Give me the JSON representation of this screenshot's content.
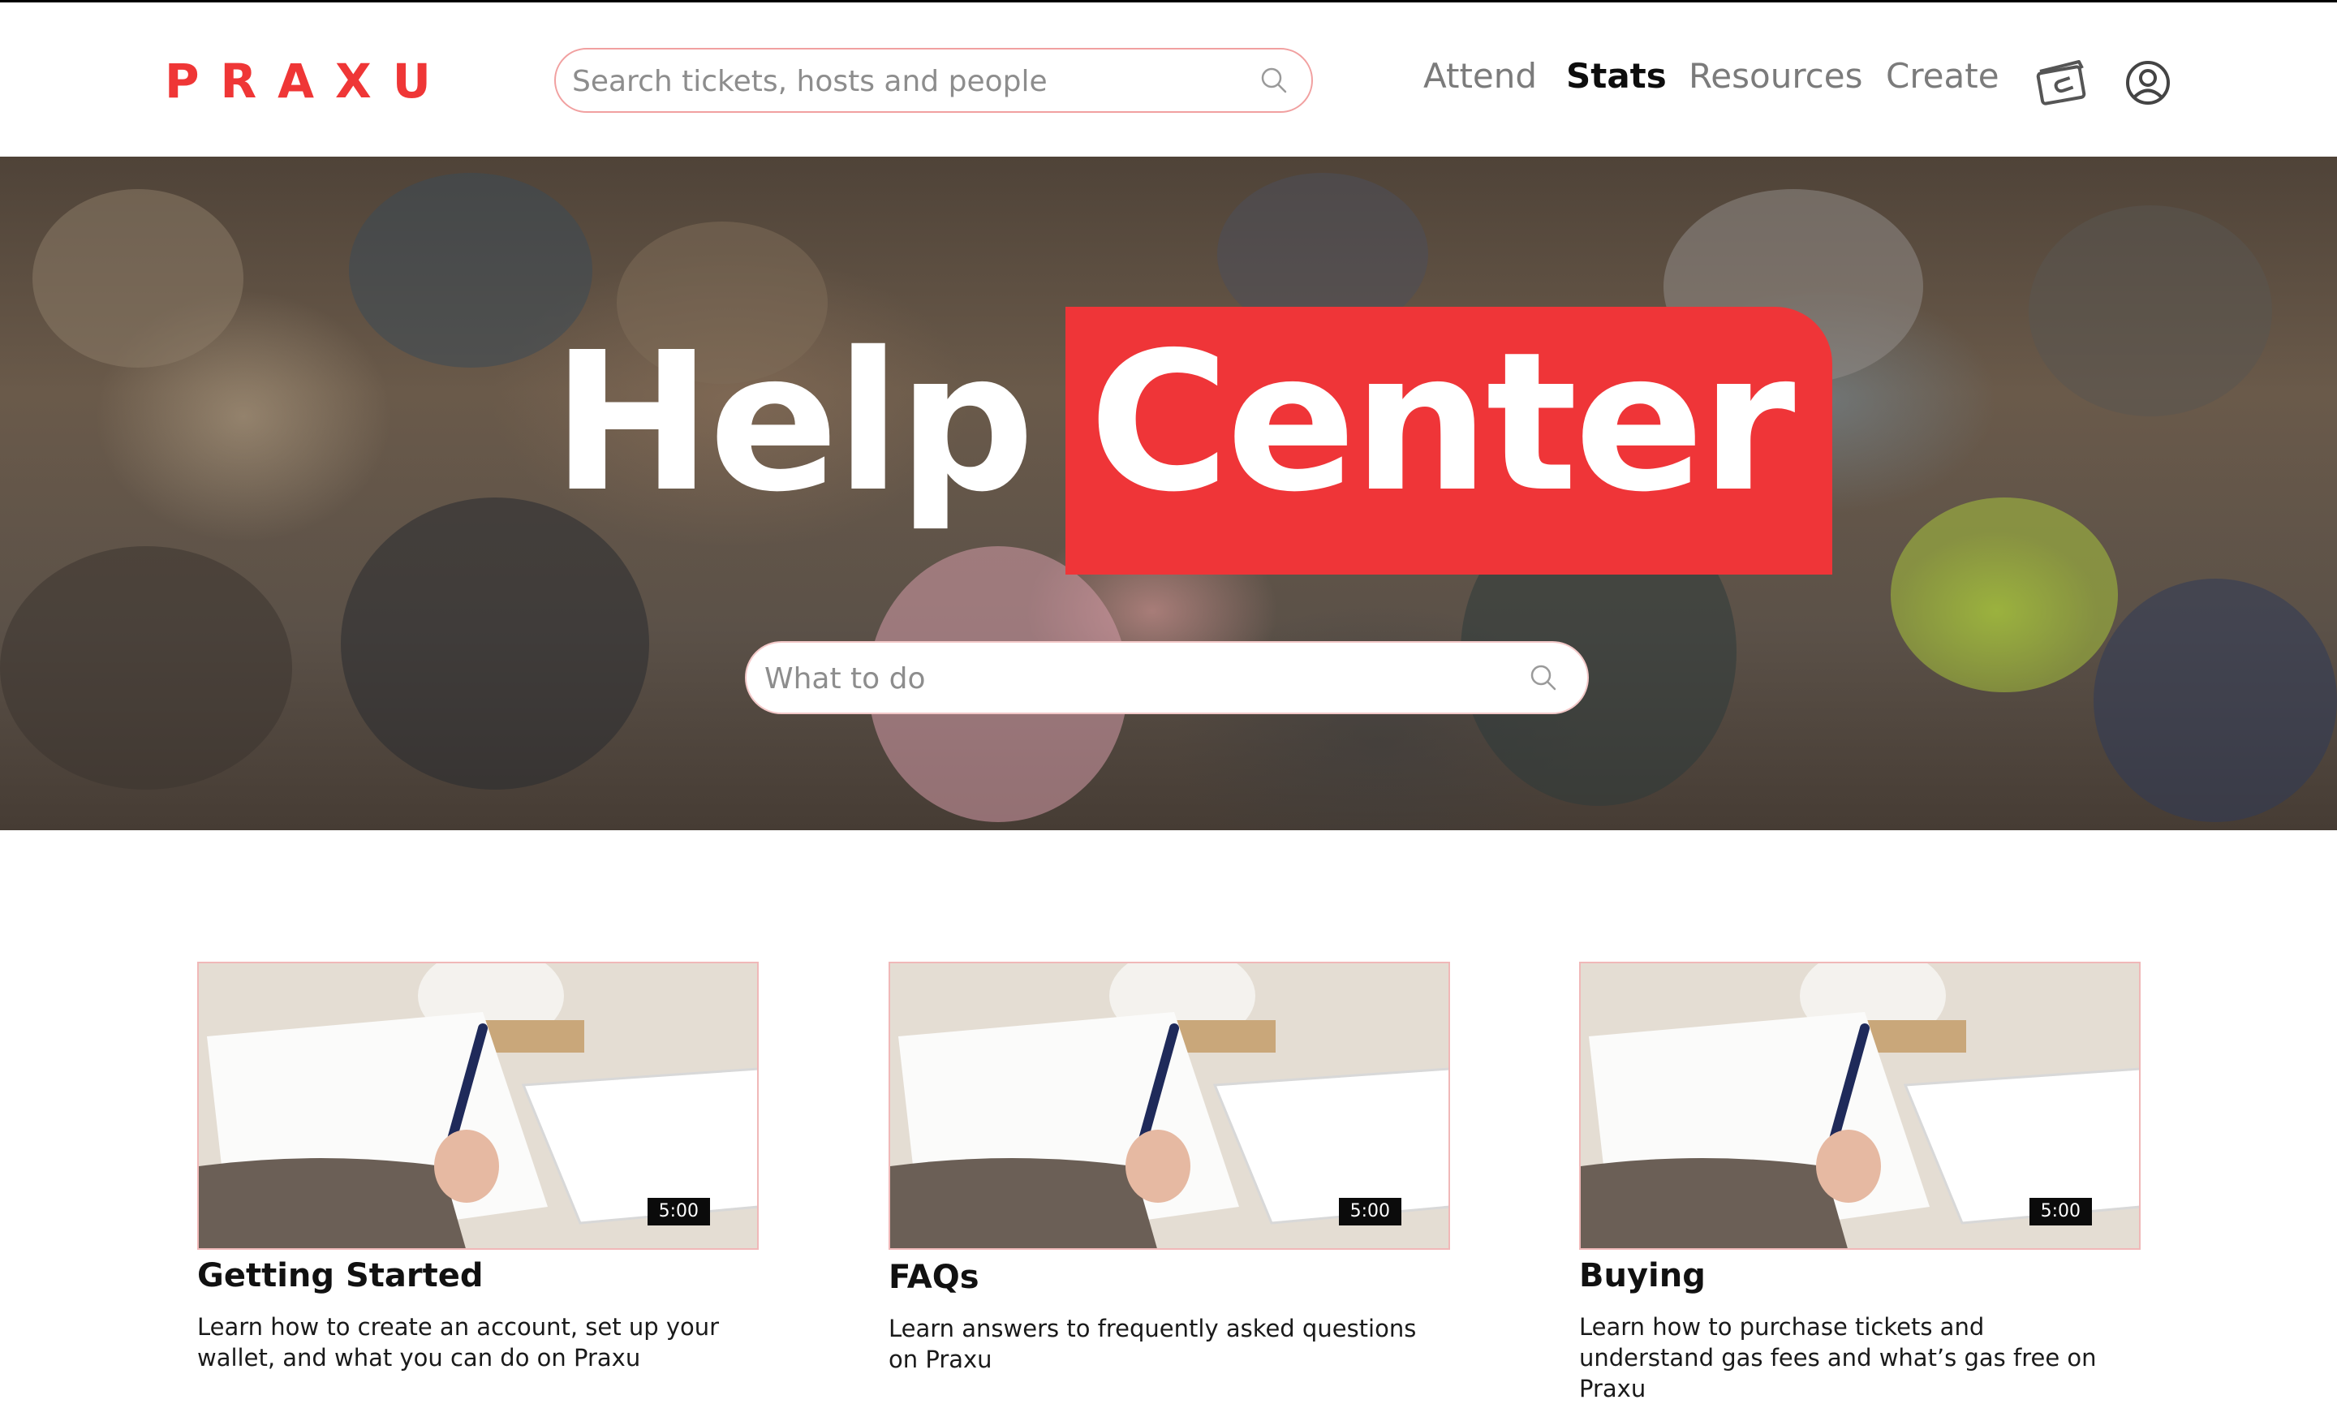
{
  "brand": {
    "logo_text": "PRAXU",
    "accent_color": "#ef3636"
  },
  "header": {
    "search_placeholder": "Search tickets, hosts and people",
    "search_icon": "search-icon",
    "nav": [
      {
        "label": "Attend",
        "active": false
      },
      {
        "label": "Stats",
        "active": true
      },
      {
        "label": "Resources",
        "active": false
      },
      {
        "label": "Create",
        "active": false
      }
    ],
    "wallet_icon": "wallet-icon",
    "profile_icon": "user-circle-icon"
  },
  "hero": {
    "title_part1": "Help",
    "title_part2": "Center",
    "search_placeholder": "What to do",
    "search_icon": "search-icon"
  },
  "cards": [
    {
      "title": "Getting Started",
      "description": "Learn how to create an account, set up your wallet, and what you can do on Praxu",
      "duration": "5:00"
    },
    {
      "title": "FAQs",
      "description": "Learn answers to frequently asked questions on Praxu",
      "duration": "5:00"
    },
    {
      "title": "Buying",
      "description": "Learn how to purchase tickets and understand gas fees and what’s gas free on Praxu",
      "duration": "5:00"
    }
  ]
}
